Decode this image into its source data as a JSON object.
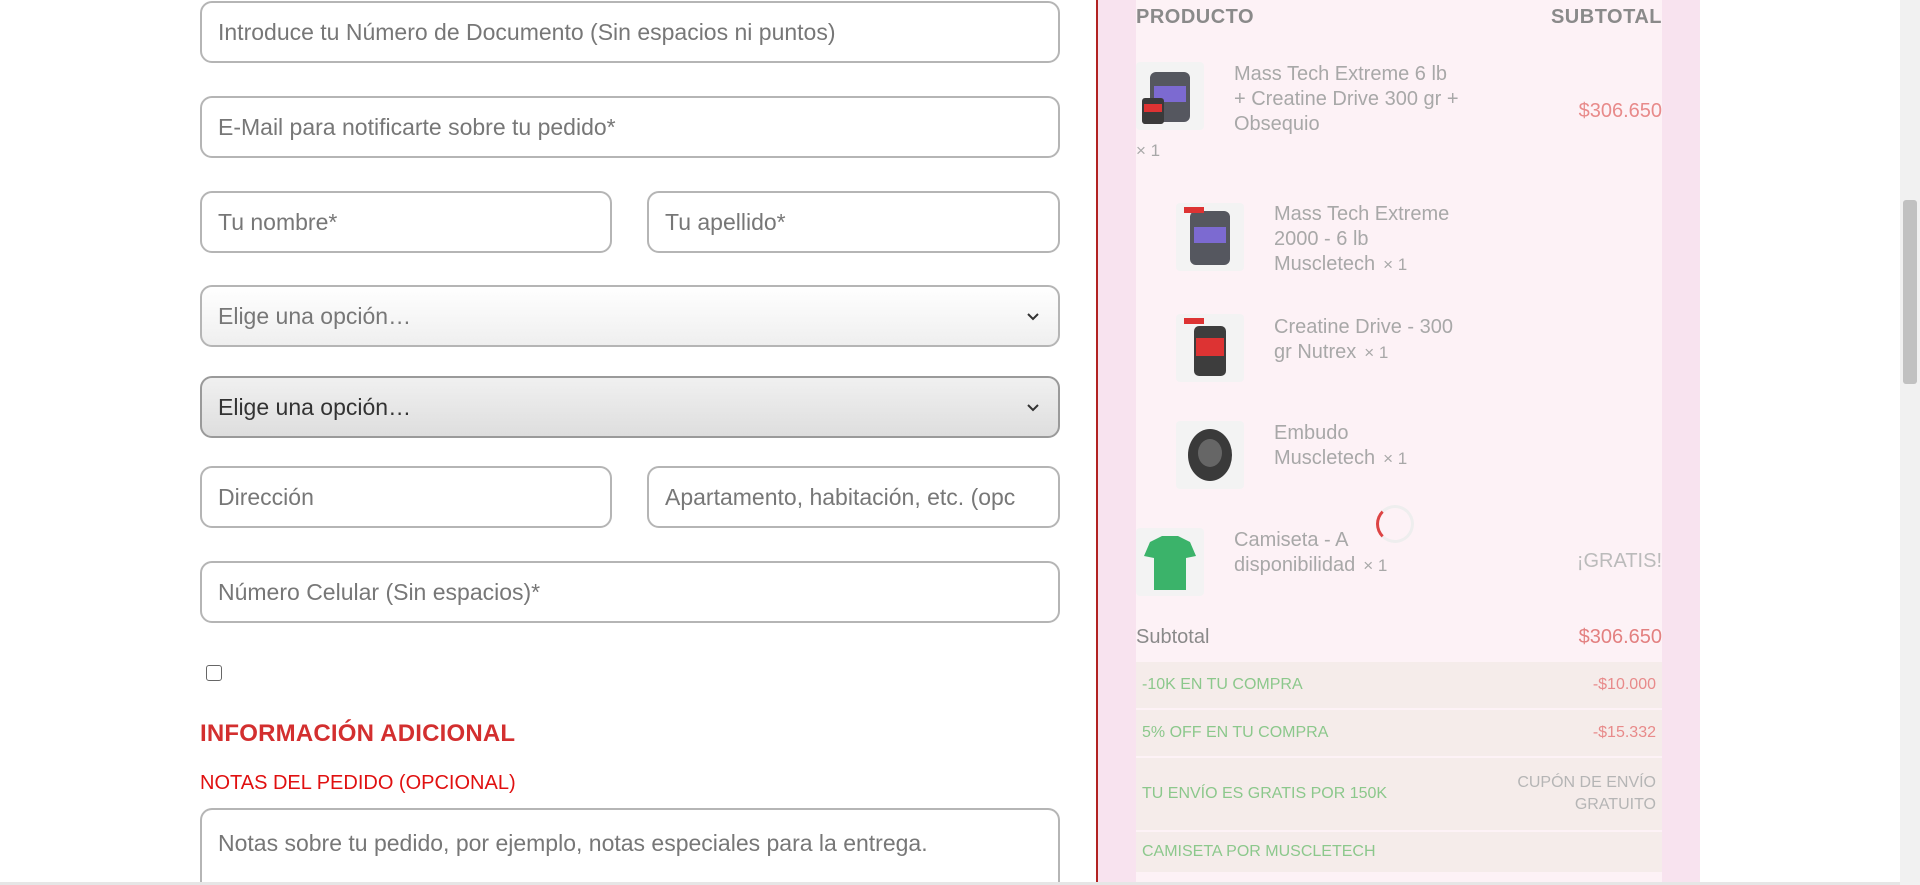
{
  "form": {
    "document_placeholder": "Introduce tu Número de Documento (Sin espacios ni puntos)",
    "email_placeholder": "E-Mail para notificarte sobre tu pedido*",
    "first_name_placeholder": "Tu nombre*",
    "last_name_placeholder": "Tu apellido*",
    "select1_value": "Elige una opción…",
    "select2_value": "Elige una opción…",
    "address_placeholder": "Dirección",
    "apartment_placeholder": "Apartamento, habitación, etc. (opc",
    "phone_placeholder": "Número Celular (Sin espacios)*",
    "additional_heading": "INFORMACIÓN ADICIONAL",
    "notes_label": "NOTAS DEL PEDIDO (OPCIONAL)",
    "notes_placeholder": "Notas sobre tu pedido, por ejemplo, notas especiales para la entrega."
  },
  "summary": {
    "col_product": "PRODUCTO",
    "col_subtotal": "SUBTOTAL",
    "main_product": {
      "name": "Mass Tech Extreme 6 lb + Creatine Drive 300 gr + Obsequio",
      "qty": "× 1",
      "price": "$306.650"
    },
    "items": [
      {
        "name": "Mass Tech Extreme 2000 - 6 lb Muscletech",
        "qty": "× 1"
      },
      {
        "name": "Creatine Drive - 300 gr Nutrex",
        "qty": "× 1"
      },
      {
        "name": "Embudo Muscletech",
        "qty": "× 1"
      }
    ],
    "gift": {
      "name": "Camiseta - A disponibilidad",
      "qty": "× 1",
      "price": "¡GRATIS!"
    },
    "subtotal_label": "Subtotal",
    "subtotal_value": "$306.650",
    "coupons": [
      {
        "name": "-10K EN TU COMPRA",
        "amount": "-$10.000"
      },
      {
        "name": "5% OFF EN TU COMPRA",
        "amount": "-$15.332"
      },
      {
        "name": "TU ENVÍO ES GRATIS POR 150K",
        "amount": "CUPÓN DE ENVÍO GRATUITO"
      },
      {
        "name": "CAMISETA POR MUSCLETECH",
        "amount": ""
      }
    ]
  },
  "colors": {
    "accent_red": "#d32f2f",
    "divider": "#b22222",
    "coupon_green": "#8cc88c",
    "summary_bg": "#f8e3ef"
  }
}
